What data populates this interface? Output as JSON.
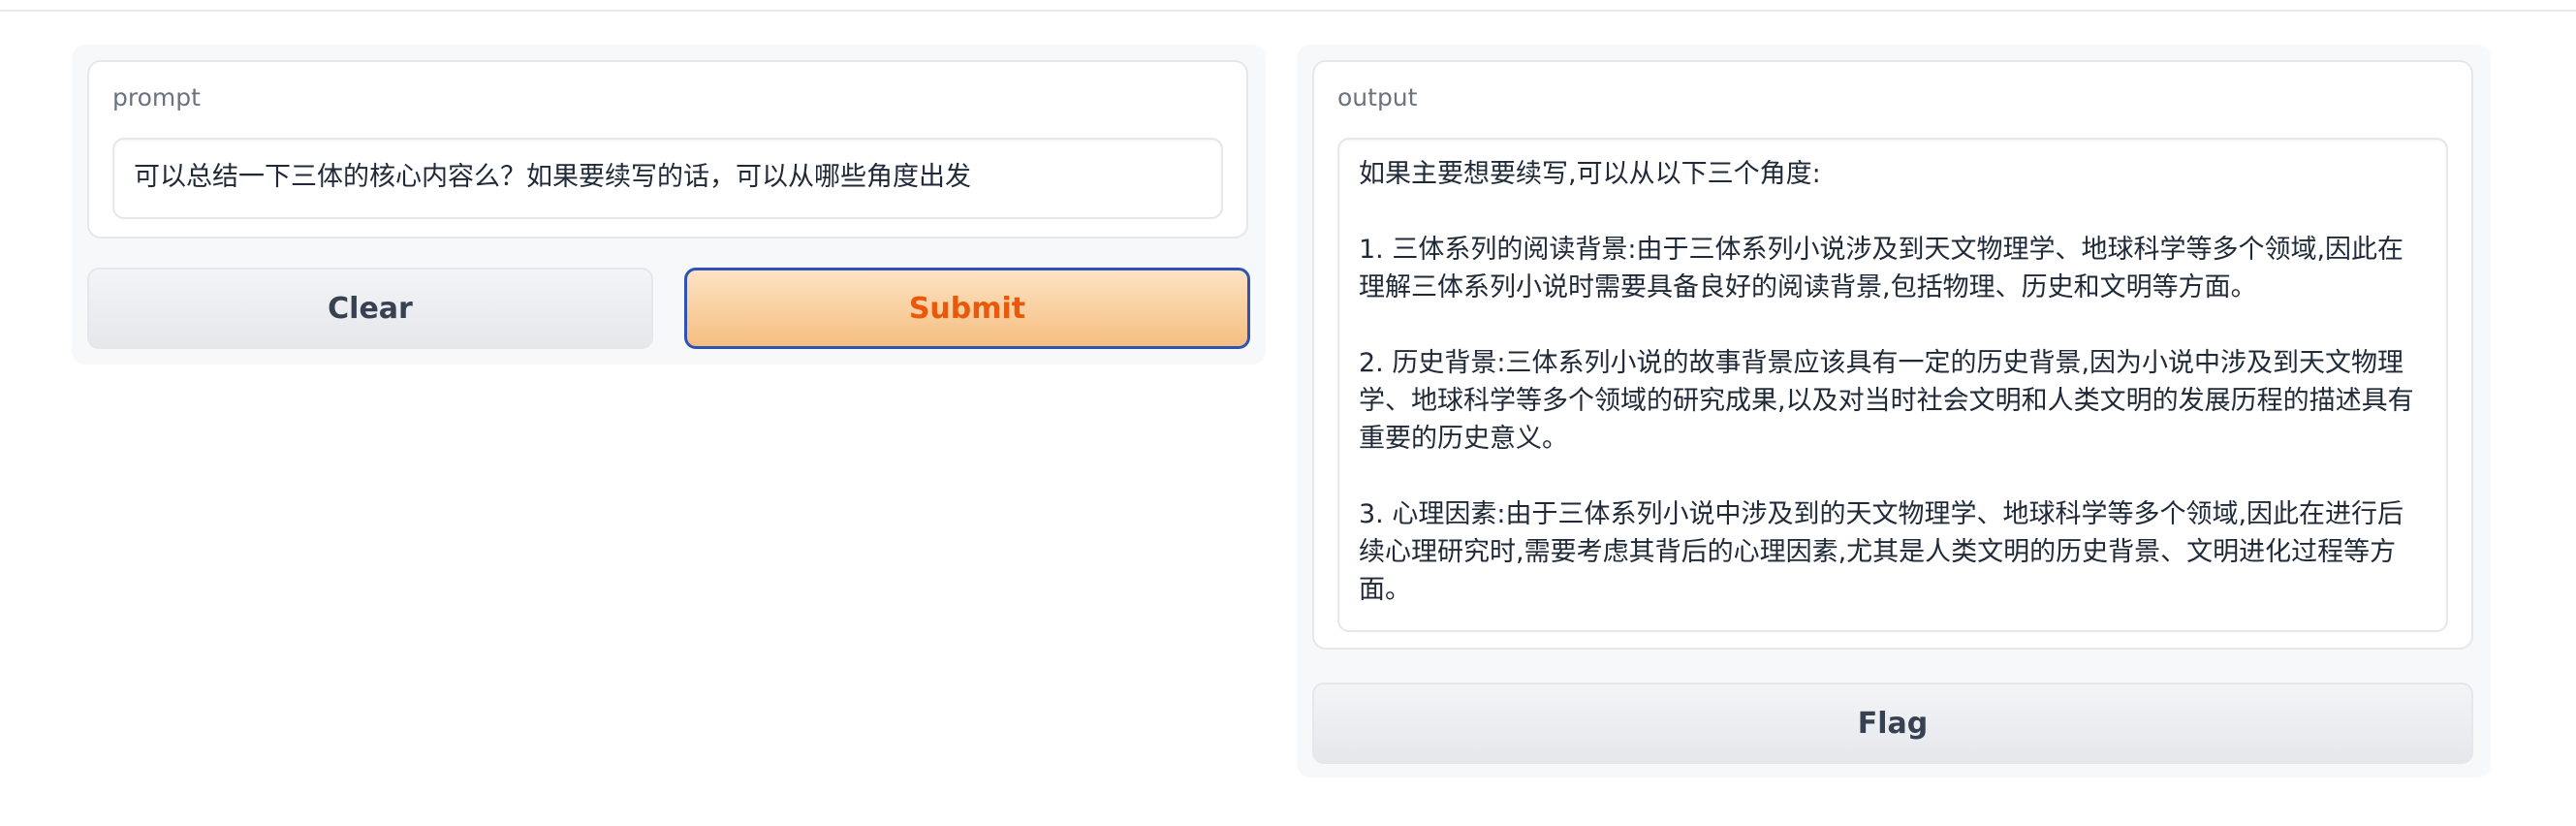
{
  "inputs": {
    "prompt_label": "prompt",
    "prompt_value": "可以总结一下三体的核心内容么？如果要续写的话，可以从哪些角度出发"
  },
  "actions": {
    "clear_label": "Clear",
    "submit_label": "Submit"
  },
  "outputs": {
    "output_label": "output",
    "output_value": "如果主要想要续写,可以从以下三个角度:\n\n1. 三体系列的阅读背景:由于三体系列小说涉及到天文物理学、地球科学等多个领域,因此在理解三体系列小说时需要具备良好的阅读背景,包括物理、历史和文明等方面。\n\n2. 历史背景:三体系列小说的故事背景应该具有一定的历史背景,因为小说中涉及到天文物理学、地球科学等多个领域的研究成果,以及对当时社会文明和人类文明的发展历程的描述具有重要的历史意义。\n\n3. 心理因素:由于三体系列小说中涉及到的天文物理学、地球科学等多个领域,因此在进行后续心理研究时,需要考虑其背后的心理因素,尤其是人类文明的历史背景、文明进化过程等方面。",
    "flag_label": "Flag"
  },
  "colors": {
    "submit_text": "#ea580c",
    "submit_border": "#2f52b5",
    "panel_bg": "#f7f8fa"
  }
}
